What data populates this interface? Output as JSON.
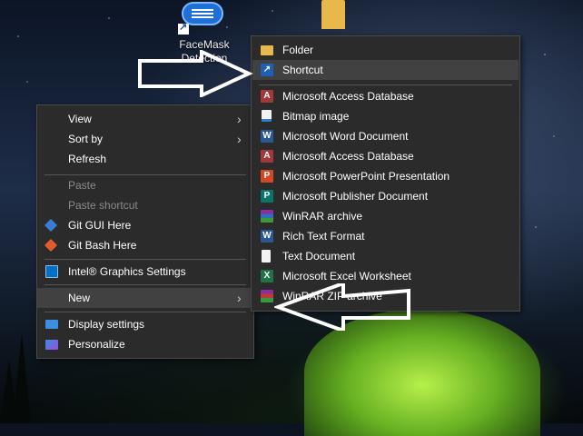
{
  "desktop": {
    "icon_label": "FaceMask Detection"
  },
  "context_menu": {
    "items": [
      {
        "label": "View",
        "submenu": true,
        "icon": ""
      },
      {
        "label": "Sort by",
        "submenu": true,
        "icon": ""
      },
      {
        "label": "Refresh",
        "icon": ""
      },
      {
        "label": "Paste",
        "disabled": true,
        "icon": ""
      },
      {
        "label": "Paste shortcut",
        "disabled": true,
        "icon": ""
      },
      {
        "label": "Git GUI Here",
        "icon": "git-gui-icon"
      },
      {
        "label": "Git Bash Here",
        "icon": "git-bash-icon"
      },
      {
        "label": "Intel® Graphics Settings",
        "icon": "intel-graphics-icon"
      },
      {
        "label": "New",
        "submenu": true,
        "highlighted": true,
        "icon": ""
      },
      {
        "label": "Display settings",
        "icon": "display-icon"
      },
      {
        "label": "Personalize",
        "icon": "personalize-icon"
      }
    ]
  },
  "new_submenu": {
    "items": [
      {
        "label": "Folder",
        "icon": "folder-icon"
      },
      {
        "label": "Shortcut",
        "icon": "shortcut-icon",
        "highlighted": true
      },
      {
        "label": "Microsoft Access Database",
        "icon": "access-icon"
      },
      {
        "label": "Bitmap image",
        "icon": "bitmap-icon"
      },
      {
        "label": "Microsoft Word Document",
        "icon": "word-icon"
      },
      {
        "label": "Microsoft Access Database",
        "icon": "access-icon"
      },
      {
        "label": "Microsoft PowerPoint Presentation",
        "icon": "powerpoint-icon"
      },
      {
        "label": "Microsoft Publisher Document",
        "icon": "publisher-icon"
      },
      {
        "label": "WinRAR archive",
        "icon": "winrar-icon"
      },
      {
        "label": "Rich Text Format",
        "icon": "rtf-icon"
      },
      {
        "label": "Text Document",
        "icon": "text-document-icon"
      },
      {
        "label": "Microsoft Excel Worksheet",
        "icon": "excel-icon"
      },
      {
        "label": "WinRAR ZIP archive",
        "icon": "winrar-zip-icon"
      }
    ]
  },
  "colors": {
    "menu_bg": "#2b2b2b",
    "highlight": "#414141",
    "disabled_text": "#8a8a8a",
    "word": "#2b5797",
    "access": "#a4373a",
    "powerpoint": "#d24726",
    "publisher": "#077568",
    "excel": "#217346"
  }
}
